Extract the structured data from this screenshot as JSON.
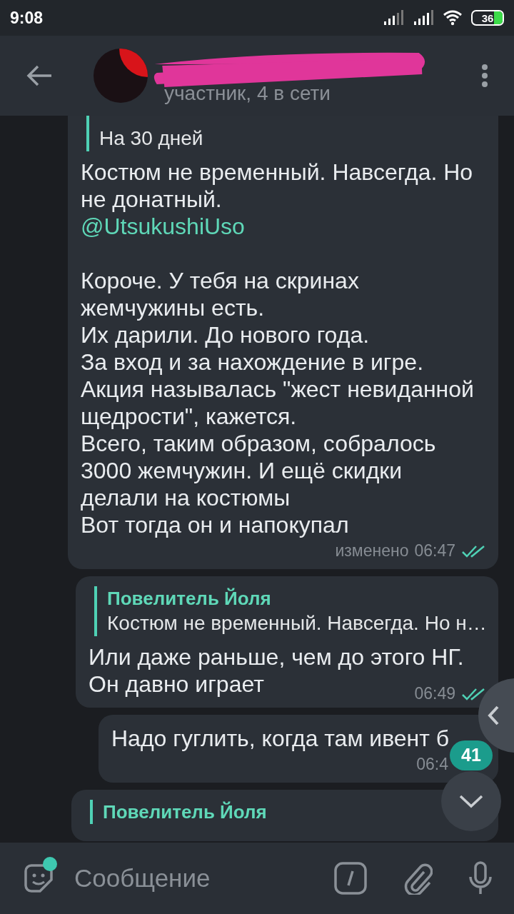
{
  "status_bar": {
    "time": "9:08",
    "battery": "36"
  },
  "header": {
    "subtitle": "участник, 4 в сети"
  },
  "messages": [
    {
      "reply": {
        "text": "На 30 дней"
      },
      "paragraphs": [
        [
          {
            "kind": "text",
            "text": "Костюм не временный. Навсегда. Но"
          },
          {
            "kind": "text",
            "text": "не донатный."
          },
          {
            "kind": "link",
            "text": "@UtsukushiUso"
          }
        ],
        [
          {
            "kind": "text",
            "text": "Короче. У тебя на скринах"
          },
          {
            "kind": "text",
            "text": "жемчужины есть."
          },
          {
            "kind": "text",
            "text": "Их дарили. До нового года."
          },
          {
            "kind": "text",
            "text": "За вход и за нахождение в игре."
          },
          {
            "kind": "text",
            "text": "Акция называлась \"жест невиданной"
          },
          {
            "kind": "text",
            "text": "щедрости\", кажется."
          },
          {
            "kind": "text",
            "text": "Всего, таким образом, собралось"
          },
          {
            "kind": "text",
            "text": "3000 жемчужин. И ещё скидки"
          },
          {
            "kind": "text",
            "text": "делали на костюмы"
          },
          {
            "kind": "text",
            "text": "Вот тогда он и напокупал"
          }
        ]
      ],
      "edited": "изменено",
      "time": "06:47",
      "read": true
    },
    {
      "reply": {
        "name": "Повелитель Йоля",
        "text": "Костюм не временный. Навсегда. Но н…"
      },
      "paragraphs": [
        [
          {
            "kind": "text",
            "text": "Или даже раньше, чем до этого НГ."
          },
          {
            "kind": "text",
            "text": "Он давно играет"
          }
        ]
      ],
      "time": "06:49",
      "read": true
    },
    {
      "paragraphs": [
        [
          {
            "kind": "text",
            "text": "Надо гуглить, когда там ивент б"
          }
        ]
      ],
      "time": "06:4",
      "read": false
    },
    {
      "reply": {
        "name": "Повелитель Йоля"
      }
    }
  ],
  "unread_badge": "41",
  "composer": {
    "placeholder": "Сообщение"
  }
}
